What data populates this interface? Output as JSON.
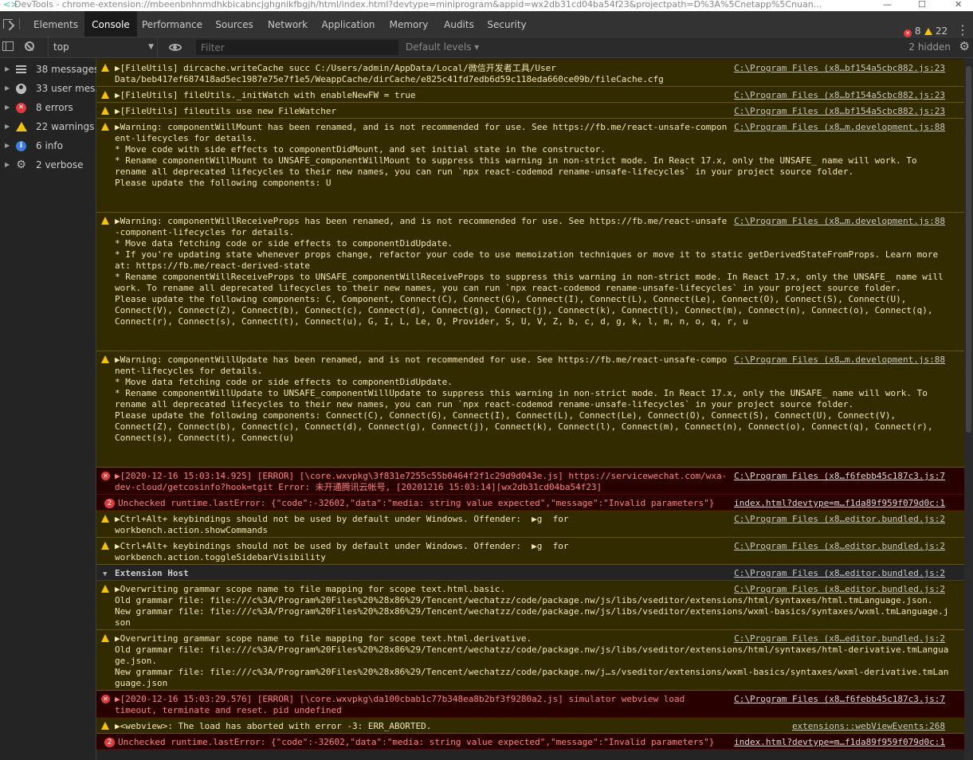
{
  "window": {
    "title": "DevTools - chrome-extension://mbeenbnhnmdhkbicabncjghgnikfbgjh/html/index.html?devtype=miniprogram&appid=wx2db31cd04ba54f23&projectpath=D%3A%5Cnetapp%5Cnuan...",
    "minimize": "—",
    "maximize": "☐",
    "close": "✕"
  },
  "tabs": [
    "Elements",
    "Console",
    "Performance",
    "Sources",
    "Network",
    "Application",
    "Memory",
    "Audits",
    "Security"
  ],
  "active_tab": "Console",
  "counts": {
    "errors": "8",
    "warnings": "22"
  },
  "toolbar": {
    "context": "top",
    "filter_placeholder": "Filter",
    "levels": "Default levels ▾",
    "hidden": "2 hidden"
  },
  "sidebar": {
    "items": [
      {
        "label": "38 messages",
        "icon": "list-icon"
      },
      {
        "label": "33 user mes...",
        "icon": "user-icon"
      },
      {
        "label": "8 errors",
        "icon": "error-icon"
      },
      {
        "label": "22 warnings",
        "icon": "warning-icon"
      },
      {
        "label": "6 info",
        "icon": "info-icon"
      },
      {
        "label": "2 verbose",
        "icon": "verbose-icon"
      }
    ]
  },
  "messages": [
    {
      "type": "warn",
      "icon": "warning-icon",
      "src": "C:\\Program Files (x8…bf154a5cbc882.js:23",
      "lines": [
        "▶[FileUtils] dircache.writeCache succ C:/Users/admin/AppData/Local/微信开发者工具/User",
        "Data/beb417ef687418ad5ec1987e75e7f1e5/WeappCache/dirCache/e825c41fd7edb6d59c118eda660ce09b/fileCache.cfg"
      ]
    },
    {
      "type": "warn",
      "icon": "warning-icon",
      "src": "C:\\Program Files (x8…bf154a5cbc882.js:23",
      "lines": [
        "▶[FileUtils] fileUtils._initWatch with enableNewFW = true"
      ]
    },
    {
      "type": "warn",
      "icon": "warning-icon",
      "src": "C:\\Program Files (x8…bf154a5cbc882.js:23",
      "lines": [
        "▶[FileUtils] fileutils use new FileWatcher"
      ]
    },
    {
      "type": "warn",
      "icon": "warning-icon",
      "src": "C:\\Program Files (x8…m.development.js:88",
      "lines": [
        "▶Warning: componentWillMount has been renamed, and is not recommended for use. See https://fb.me/react-unsafe-compon",
        "ent-lifecycles for details.",
        "",
        "* Move code with side effects to componentDidMount, and set initial state in the constructor.",
        "* Rename componentWillMount to UNSAFE_componentWillMount to suppress this warning in non-strict mode. In React 17.x, only the UNSAFE_ name will work. To",
        "rename all deprecated lifecycles to their new names, you can run `npx react-codemod rename-unsafe-lifecycles` in your project source folder.",
        "",
        "Please update the following components: U"
      ]
    },
    {
      "type": "warn",
      "icon": "warning-icon",
      "src": "C:\\Program Files (x8…m.development.js:88",
      "lines": [
        "▶Warning: componentWillReceiveProps has been renamed, and is not recommended for use. See https://fb.me/react-unsafe",
        "-component-lifecycles for details.",
        "",
        "* Move data fetching code or side effects to componentDidUpdate.",
        "* If you're updating state whenever props change, refactor your code to use memoization techniques or move it to static getDerivedStateFromProps. Learn more",
        "at: https://fb.me/react-derived-state",
        "* Rename componentWillReceiveProps to UNSAFE_componentWillReceiveProps to suppress this warning in non-strict mode. In React 17.x, only the UNSAFE_ name will",
        "work. To rename all deprecated lifecycles to their new names, you can run `npx react-codemod rename-unsafe-lifecycles` in your project source folder.",
        "",
        "Please update the following components: C, Component, Connect(C), Connect(G), Connect(I), Connect(L), Connect(Le), Connect(O), Connect(S), Connect(U),",
        "Connect(V), Connect(Z), Connect(b), Connect(c), Connect(d), Connect(g), Connect(j), Connect(k), Connect(l), Connect(m), Connect(n), Connect(o), Connect(q),",
        "Connect(r), Connect(s), Connect(t), Connect(u), G, I, L, Le, O, Provider, S, U, V, Z, b, c, d, g, k, l, m, n, o, q, r, u"
      ]
    },
    {
      "type": "warn",
      "icon": "warning-icon",
      "src": "C:\\Program Files (x8…m.development.js:88",
      "lines": [
        "▶Warning: componentWillUpdate has been renamed, and is not recommended for use. See https://fb.me/react-unsafe-compo",
        "nent-lifecycles for details.",
        "",
        "* Move data fetching code or side effects to componentDidUpdate.",
        "* Rename componentWillUpdate to UNSAFE_componentWillUpdate to suppress this warning in non-strict mode. In React 17.x, only the UNSAFE_ name will work. To",
        "rename all deprecated lifecycles to their new names, you can run `npx react-codemod rename-unsafe-lifecycles` in your project source folder.",
        "",
        "Please update the following components: Connect(C), Connect(G), Connect(I), Connect(L), Connect(Le), Connect(O), Connect(S), Connect(U), Connect(V),",
        "Connect(Z), Connect(b), Connect(c), Connect(d), Connect(g), Connect(j), Connect(k), Connect(l), Connect(m), Connect(n), Connect(o), Connect(q), Connect(r),",
        "Connect(s), Connect(t), Connect(u)"
      ]
    },
    {
      "type": "error",
      "icon": "error-icon",
      "src": "C:\\Program Files (x8…f6febb45c187c3.js:7",
      "lines": [
        "▶[2020-12-16 15:03:14.925] [ERROR] [\\core.wxvpkg\\3f831e7255c55b0464f2f1c29d9d043e.js] https://servicewechat.com/wxa-",
        "dev-cloud/getcosinfo?hook=tgit Error: 未开通腾讯云帐号, [20201216 15:03:14][wx2db31cd04ba54f23]"
      ]
    },
    {
      "type": "error",
      "icon": "count-badge",
      "count": "2",
      "src": "index.html?devtype=m…f1da89f959f079d0c:1",
      "lines": [
        "Unchecked runtime.lastError: {\"code\":-32602,\"data\":\"media: string value expected\",\"message\":\"Invalid parameters\"}"
      ]
    },
    {
      "type": "warn",
      "icon": "warning-icon",
      "src": "C:\\Program Files (x8…editor.bundled.js:2",
      "lines": [
        "▶Ctrl+Alt+ keybindings should not be used by default under Windows. Offender:  ▶g  for",
        "workbench.action.showCommands"
      ]
    },
    {
      "type": "warn",
      "icon": "warning-icon",
      "src": "C:\\Program Files (x8…editor.bundled.js:2",
      "lines": [
        "▶Ctrl+Alt+ keybindings should not be used by default under Windows. Offender:  ▶g  for",
        "workbench.action.toggleSidebarVisibility"
      ]
    },
    {
      "type": "plain",
      "icon": "group-arrow",
      "src": "C:\\Program Files (x8…editor.bundled.js:2",
      "lines": [
        "Extension Host"
      ]
    },
    {
      "type": "warn",
      "icon": "warning-icon",
      "src": "C:\\Program Files (x8…editor.bundled.js:2",
      "lines": [
        "▶Overwriting grammar scope name to file mapping for scope text.html.basic.",
        "Old grammar file: file:///c%3A/Program%20Files%20%28x86%29/Tencent/wechatzz/code/package.nw/js/libs/vseditor/extensions/html/syntaxes/html.tmLanguage.json.",
        "New grammar file: file:///c%3A/Program%20Files%20%28x86%29/Tencent/wechatzz/code/package.nw/js/libs/vseditor/extensions/wxml-basics/syntaxes/wxml.tmLanguage.j",
        "son"
      ]
    },
    {
      "type": "warn",
      "icon": "warning-icon",
      "src": "C:\\Program Files (x8…editor.bundled.js:2",
      "lines": [
        "▶Overwriting grammar scope name to file mapping for scope text.html.derivative.",
        "Old grammar file: file:///c%3A/Program%20Files%20%28x86%29/Tencent/wechatzz/code/package.nw/js/libs/vseditor/extensions/html/syntaxes/html-derivative.tmLangua",
        "ge.json.",
        "New grammar file: file:///c%3A/Program%20Files%20%28x86%29/Tencent/wechatzz/code/package.nw/j…s/vseditor/extensions/wxml-basics/syntaxes/wxml-derivative.tmLan",
        "guage.json"
      ]
    },
    {
      "type": "error",
      "icon": "error-icon",
      "src": "C:\\Program Files (x8…f6febb45c187c3.js:7",
      "lines": [
        "▶[2020-12-16 15:03:29.576] [ERROR] [\\core.wxvpkg\\da100cbab1c77b348ea8b2bf3f9280a2.js] simulator webview load",
        "timeout, terminate and reset. pid undefined"
      ]
    },
    {
      "type": "warn",
      "icon": "warning-icon",
      "src": "extensions::webViewEvents:268",
      "lines": [
        "▶<webview>: The load has aborted with error -3: ERR_ABORTED."
      ]
    },
    {
      "type": "error",
      "icon": "count-badge",
      "count": "2",
      "src": "index.html?devtype=m…f1da89f959f079d0c:1",
      "lines": [
        "Unchecked runtime.lastError: {\"code\":-32602,\"data\":\"media: string value expected\",\"message\":\"Invalid parameters\"}"
      ]
    }
  ]
}
